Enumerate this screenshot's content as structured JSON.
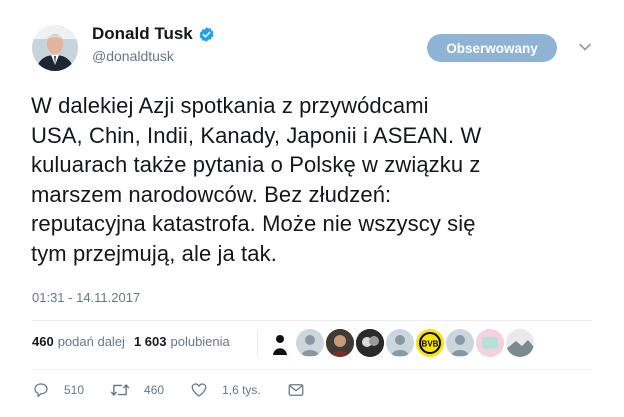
{
  "user": {
    "display_name": "Donald Tusk",
    "handle": "@donaldtusk",
    "verified": true
  },
  "follow_button": {
    "label": "Obserwowany",
    "color": "#8fb3d4"
  },
  "tweet": {
    "text_lines": [
      "W dalekiej Azji spotkania z przywódcami",
      "USA, Chin, Indii, Kanady, Japonii i ASEAN. W",
      "kuluarach także pytania o Polskę w związku z",
      "marszem narodowców. Bez złudzeń:",
      "reputacyjna katastrofa. Może nie wszyscy się",
      "tym przejmują, ale ja tak."
    ],
    "timestamp": "01:31 - 14.11.2017"
  },
  "stats": {
    "retweets_count": "460",
    "retweets_label": "podań dalej",
    "likes_count": "1 603",
    "likes_label": "polubienia"
  },
  "liker_avatars": [
    "silhouette-avatar",
    "default-avatar",
    "photo-avatar",
    "photo-avatar",
    "default-avatar",
    "bvb-logo-avatar",
    "default-avatar",
    "pink-avatar",
    "landscape-avatar"
  ],
  "actions": {
    "reply_count": "510",
    "retweet_count": "460",
    "like_count": "1,6 tys."
  },
  "colors": {
    "accent": "#1da1f2",
    "muted": "#657786",
    "text": "#14171a"
  }
}
